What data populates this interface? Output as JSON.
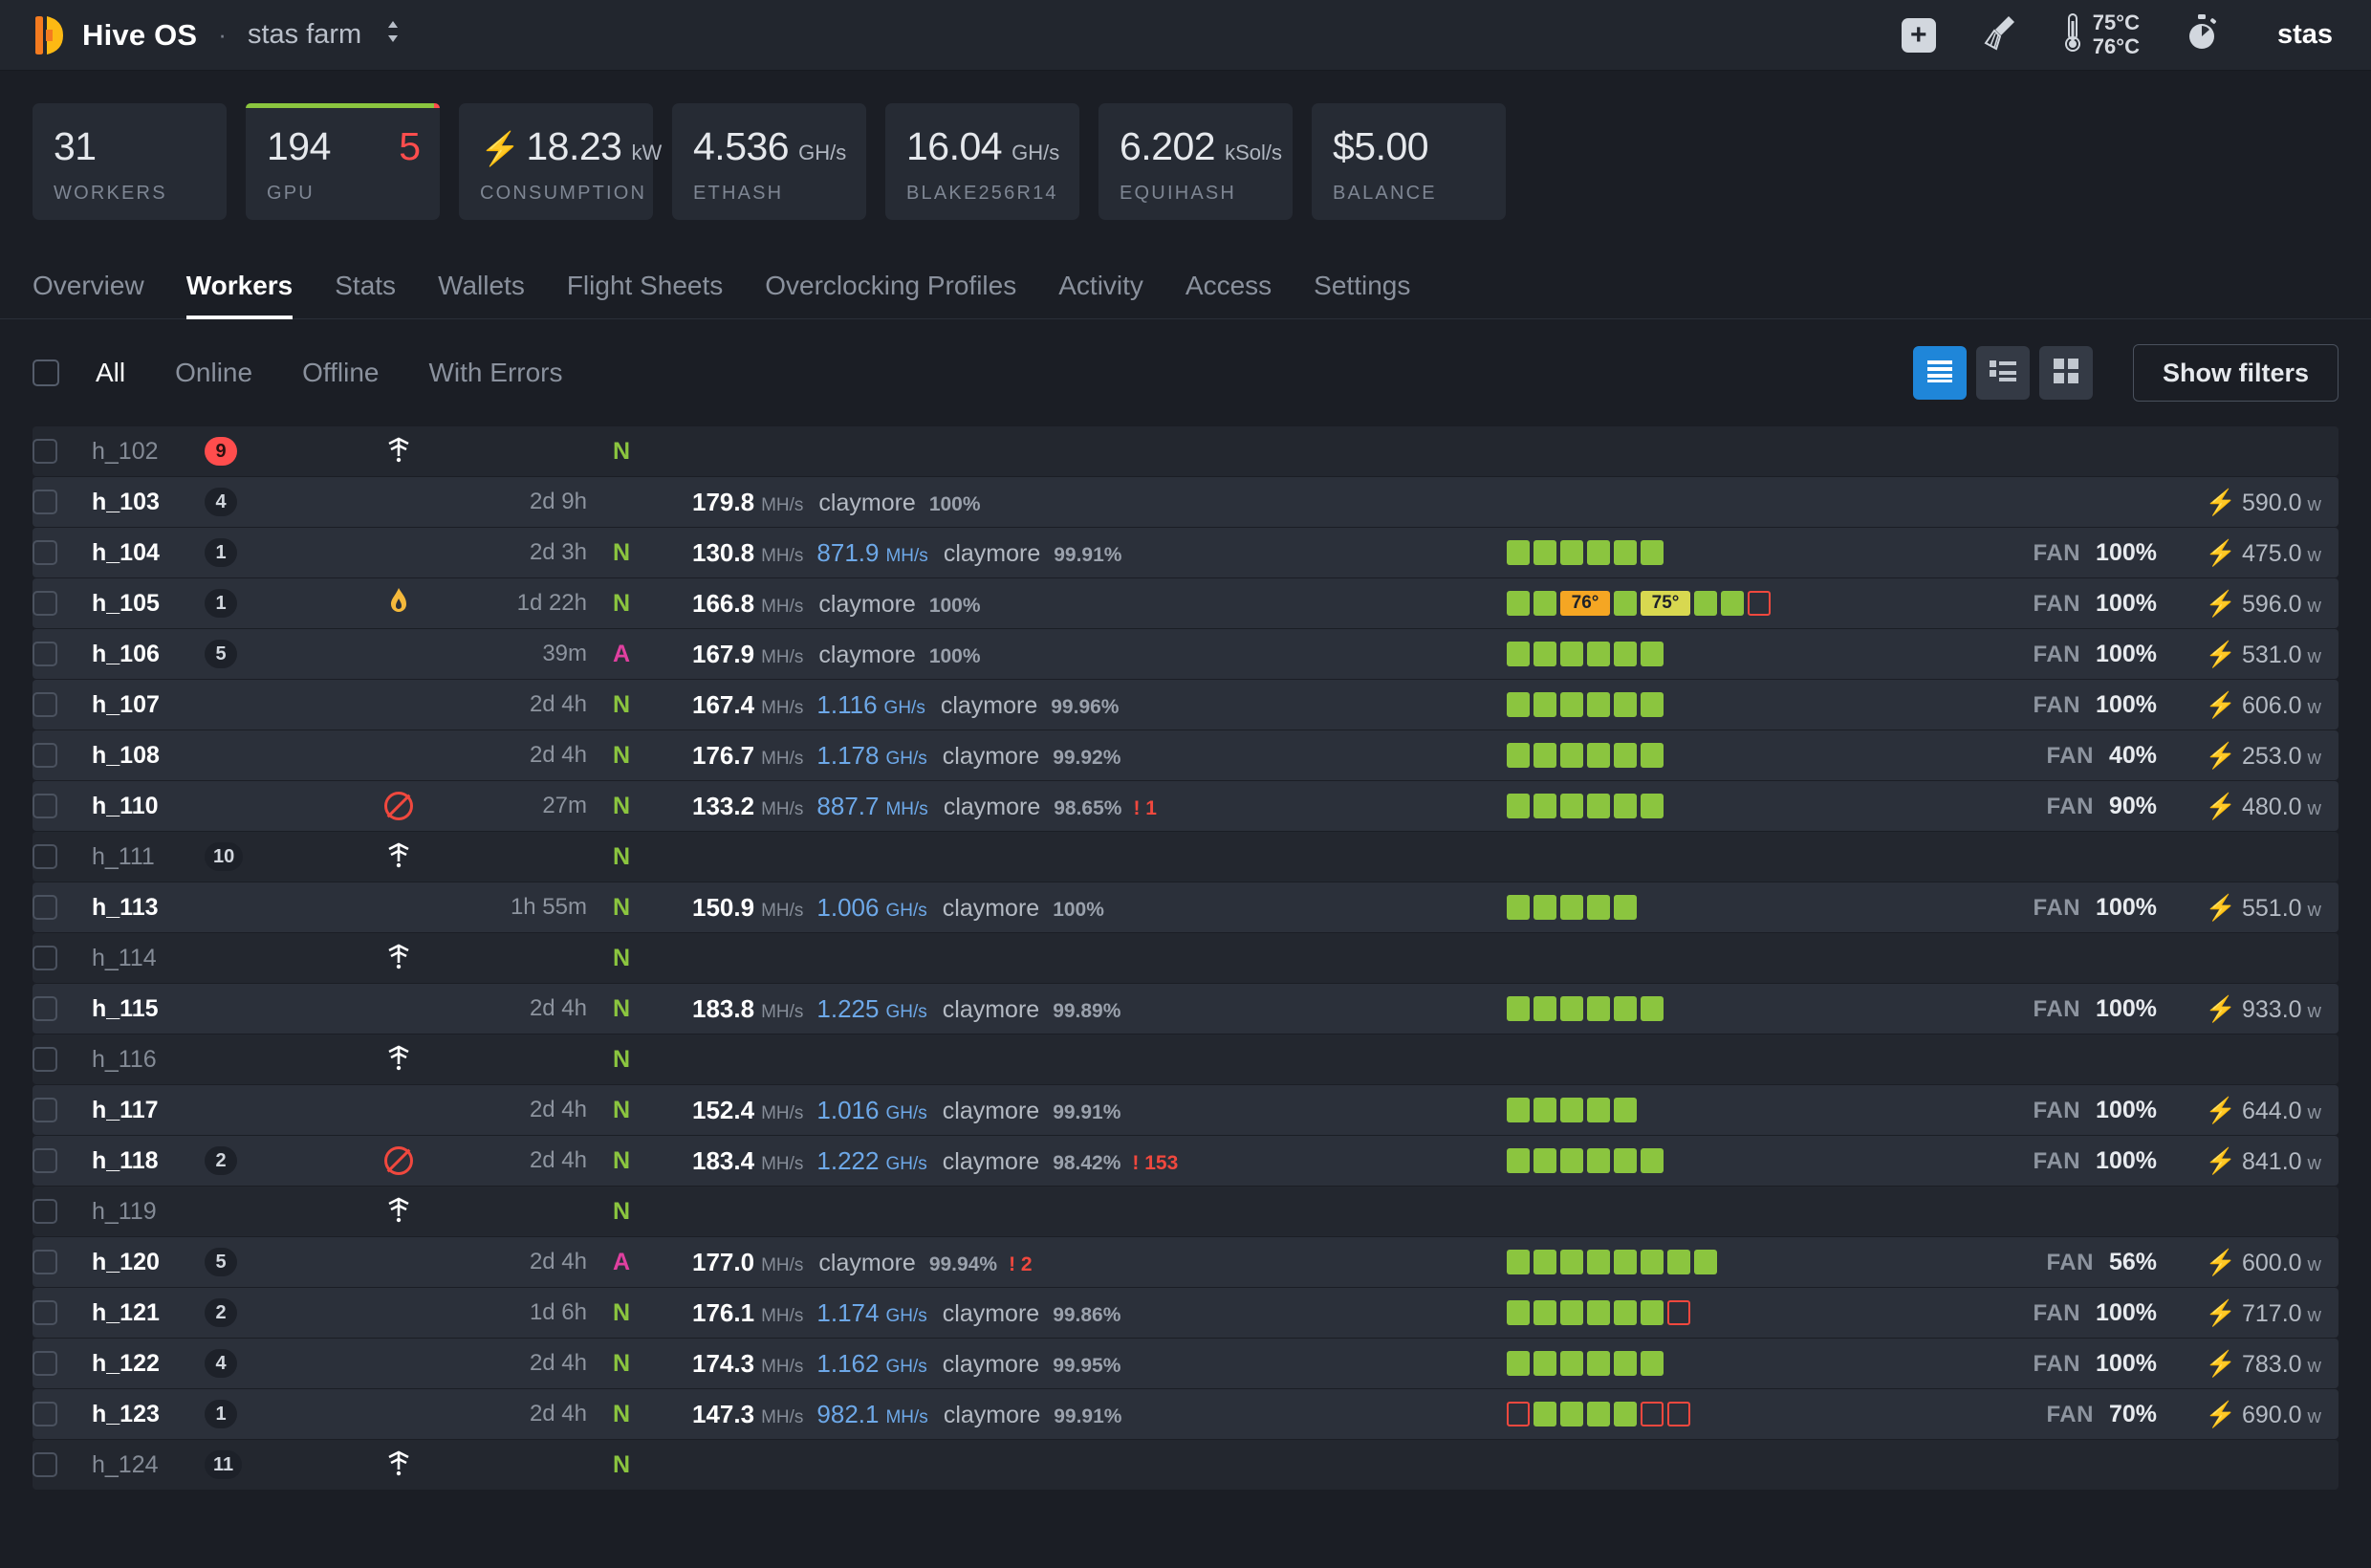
{
  "topbar": {
    "brand": "Hive OS",
    "separator": "·",
    "farm": "stas farm",
    "caret": "⌃⌄",
    "add_icon": "+",
    "broom_icon": "broom-icon",
    "temp_gpu": "75°C",
    "temp_cpu": "76°C",
    "timer_icon": "stopwatch-icon",
    "user": "stas"
  },
  "cards": [
    {
      "value": "31",
      "unit": "",
      "label": "WORKERS",
      "bolt": false,
      "err": "",
      "bar": null
    },
    {
      "value": "194",
      "unit": "",
      "label": "GPU",
      "bolt": false,
      "err": "5",
      "bar": {
        "ok_pct": 97,
        "err_pct": 3
      }
    },
    {
      "value": "18.23",
      "unit": "kW",
      "label": "CONSUMPTION",
      "bolt": true,
      "err": "",
      "bar": null
    },
    {
      "value": "4.536",
      "unit": "GH/s",
      "label": "ETHASH",
      "bolt": false,
      "err": "",
      "bar": null
    },
    {
      "value": "16.04",
      "unit": "GH/s",
      "label": "BLAKE256R14",
      "bolt": false,
      "err": "",
      "bar": null
    },
    {
      "value": "6.202",
      "unit": "kSol/s",
      "label": "EQUIHASH",
      "bolt": false,
      "err": "",
      "bar": null
    },
    {
      "value": "$5.00",
      "unit": "",
      "label": "BALANCE",
      "bolt": false,
      "err": "",
      "bar": null
    }
  ],
  "nav_tabs": [
    {
      "label": "Overview",
      "active": false
    },
    {
      "label": "Workers",
      "active": true
    },
    {
      "label": "Stats",
      "active": false
    },
    {
      "label": "Wallets",
      "active": false
    },
    {
      "label": "Flight Sheets",
      "active": false
    },
    {
      "label": "Overclocking Profiles",
      "active": false
    },
    {
      "label": "Activity",
      "active": false
    },
    {
      "label": "Access",
      "active": false
    },
    {
      "label": "Settings",
      "active": false
    }
  ],
  "filters": {
    "chips": [
      {
        "label": "All",
        "active": true
      },
      {
        "label": "Online",
        "active": false
      },
      {
        "label": "Offline",
        "active": false
      },
      {
        "label": "With Errors",
        "active": false
      }
    ],
    "views": [
      {
        "icon": "list-rows-icon",
        "active": true
      },
      {
        "icon": "list-detail-icon",
        "active": false
      },
      {
        "icon": "grid-icon",
        "active": false
      }
    ],
    "show_filters_label": "Show filters"
  },
  "colors": {
    "accent": "#1f86d9",
    "ok": "#8bc53f",
    "warn": "#f5a623",
    "warn2": "#d8d850",
    "error": "#f0483e",
    "hash_blue": "#6da8e8",
    "net_alt": "#e040a0",
    "row_bg": "#2b303a",
    "row_bg_offline": "#23272f",
    "page_bg": "#1b1e25"
  },
  "workers": [
    {
      "name": "h_102",
      "badge": "9",
      "badge_red": true,
      "status": "offline",
      "uptime": "",
      "net": "N",
      "net_class": "net-N",
      "offline": true,
      "hash": "",
      "unit": "",
      "hash2": "",
      "unit2": "",
      "miner": "",
      "pct": "",
      "err": "",
      "gpus": [],
      "fan": "",
      "fan_label": "",
      "power": "",
      "power_unit": ""
    },
    {
      "name": "h_103",
      "badge": "4",
      "badge_red": false,
      "status": "",
      "uptime": "2d 9h",
      "net": "",
      "net_class": "",
      "offline": false,
      "hash": "179.8",
      "unit": "MH/s",
      "hash2": "",
      "unit2": "",
      "miner": "claymore",
      "pct": "100%",
      "err": "",
      "gpus": [],
      "fan": "",
      "fan_label": "",
      "power": "590.0",
      "power_unit": "w"
    },
    {
      "name": "h_104",
      "badge": "1",
      "badge_red": false,
      "status": "",
      "uptime": "2d 3h",
      "net": "N",
      "net_class": "net-N",
      "offline": false,
      "hash": "130.8",
      "unit": "MH/s",
      "hash2": "871.9",
      "unit2": "MH/s",
      "miner": "claymore",
      "pct": "99.91%",
      "err": "",
      "gpus": [
        {
          "t": "",
          "c": "ok"
        },
        {
          "t": "",
          "c": "ok"
        },
        {
          "t": "",
          "c": "ok"
        },
        {
          "t": "",
          "c": "ok"
        },
        {
          "t": "",
          "c": "ok"
        },
        {
          "t": "",
          "c": "ok"
        }
      ],
      "fan": "100%",
      "fan_label": "FAN",
      "power": "475.0",
      "power_unit": "w"
    },
    {
      "name": "h_105",
      "badge": "1",
      "badge_red": false,
      "status": "flame",
      "uptime": "1d 22h",
      "net": "N",
      "net_class": "net-N",
      "offline": false,
      "hash": "166.8",
      "unit": "MH/s",
      "hash2": "",
      "unit2": "",
      "miner": "claymore",
      "pct": "100%",
      "err": "",
      "gpus": [
        {
          "t": "",
          "c": "ok"
        },
        {
          "t": "",
          "c": "ok"
        },
        {
          "t": "76°",
          "c": "orange"
        },
        {
          "t": "",
          "c": "ok"
        },
        {
          "t": "75°",
          "c": "yellow"
        },
        {
          "t": "",
          "c": "ok"
        },
        {
          "t": "",
          "c": "ok"
        },
        {
          "t": "",
          "c": "empty"
        }
      ],
      "fan": "100%",
      "fan_label": "FAN",
      "power": "596.0",
      "power_unit": "w"
    },
    {
      "name": "h_106",
      "badge": "5",
      "badge_red": false,
      "status": "",
      "uptime": "39m",
      "net": "A",
      "net_class": "net-A",
      "offline": false,
      "hash": "167.9",
      "unit": "MH/s",
      "hash2": "",
      "unit2": "",
      "miner": "claymore",
      "pct": "100%",
      "err": "",
      "gpus": [
        {
          "t": "",
          "c": "ok"
        },
        {
          "t": "",
          "c": "ok"
        },
        {
          "t": "",
          "c": "ok"
        },
        {
          "t": "",
          "c": "ok"
        },
        {
          "t": "",
          "c": "ok"
        },
        {
          "t": "",
          "c": "ok"
        }
      ],
      "fan": "100%",
      "fan_label": "FAN",
      "power": "531.0",
      "power_unit": "w"
    },
    {
      "name": "h_107",
      "badge": "",
      "badge_red": false,
      "status": "",
      "uptime": "2d 4h",
      "net": "N",
      "net_class": "net-N",
      "offline": false,
      "hash": "167.4",
      "unit": "MH/s",
      "hash2": "1.116",
      "unit2": "GH/s",
      "miner": "claymore",
      "pct": "99.96%",
      "err": "",
      "gpus": [
        {
          "t": "",
          "c": "ok"
        },
        {
          "t": "",
          "c": "ok"
        },
        {
          "t": "",
          "c": "ok"
        },
        {
          "t": "",
          "c": "ok"
        },
        {
          "t": "",
          "c": "ok"
        },
        {
          "t": "",
          "c": "ok"
        }
      ],
      "fan": "100%",
      "fan_label": "FAN",
      "power": "606.0",
      "power_unit": "w"
    },
    {
      "name": "h_108",
      "badge": "",
      "badge_red": false,
      "status": "",
      "uptime": "2d 4h",
      "net": "N",
      "net_class": "net-N",
      "offline": false,
      "hash": "176.7",
      "unit": "MH/s",
      "hash2": "1.178",
      "unit2": "GH/s",
      "miner": "claymore",
      "pct": "99.92%",
      "err": "",
      "gpus": [
        {
          "t": "",
          "c": "ok"
        },
        {
          "t": "",
          "c": "ok"
        },
        {
          "t": "",
          "c": "ok"
        },
        {
          "t": "",
          "c": "ok"
        },
        {
          "t": "",
          "c": "ok"
        },
        {
          "t": "",
          "c": "ok"
        }
      ],
      "fan": "40%",
      "fan_label": "FAN",
      "power": "253.0",
      "power_unit": "w"
    },
    {
      "name": "h_110",
      "badge": "",
      "badge_red": false,
      "status": "noentry",
      "uptime": "27m",
      "net": "N",
      "net_class": "net-N",
      "offline": false,
      "hash": "133.2",
      "unit": "MH/s",
      "hash2": "887.7",
      "unit2": "MH/s",
      "miner": "claymore",
      "pct": "98.65%",
      "err": "! 1",
      "gpus": [
        {
          "t": "",
          "c": "ok"
        },
        {
          "t": "",
          "c": "ok"
        },
        {
          "t": "",
          "c": "ok"
        },
        {
          "t": "",
          "c": "ok"
        },
        {
          "t": "",
          "c": "ok"
        },
        {
          "t": "",
          "c": "ok"
        }
      ],
      "fan": "90%",
      "fan_label": "FAN",
      "power": "480.0",
      "power_unit": "w"
    },
    {
      "name": "h_111",
      "badge": "10",
      "badge_red": false,
      "status": "offline",
      "uptime": "",
      "net": "N",
      "net_class": "net-N",
      "offline": true,
      "hash": "",
      "unit": "",
      "hash2": "",
      "unit2": "",
      "miner": "",
      "pct": "",
      "err": "",
      "gpus": [],
      "fan": "",
      "fan_label": "",
      "power": "",
      "power_unit": ""
    },
    {
      "name": "h_113",
      "badge": "",
      "badge_red": false,
      "status": "",
      "uptime": "1h 55m",
      "net": "N",
      "net_class": "net-N",
      "offline": false,
      "hash": "150.9",
      "unit": "MH/s",
      "hash2": "1.006",
      "unit2": "GH/s",
      "miner": "claymore",
      "pct": "100%",
      "err": "",
      "gpus": [
        {
          "t": "",
          "c": "ok"
        },
        {
          "t": "",
          "c": "ok"
        },
        {
          "t": "",
          "c": "ok"
        },
        {
          "t": "",
          "c": "ok"
        },
        {
          "t": "",
          "c": "ok"
        }
      ],
      "fan": "100%",
      "fan_label": "FAN",
      "power": "551.0",
      "power_unit": "w"
    },
    {
      "name": "h_114",
      "badge": "",
      "badge_red": false,
      "status": "offline",
      "uptime": "",
      "net": "N",
      "net_class": "net-N",
      "offline": true,
      "hash": "",
      "unit": "",
      "hash2": "",
      "unit2": "",
      "miner": "",
      "pct": "",
      "err": "",
      "gpus": [],
      "fan": "",
      "fan_label": "",
      "power": "",
      "power_unit": ""
    },
    {
      "name": "h_115",
      "badge": "",
      "badge_red": false,
      "status": "",
      "uptime": "2d 4h",
      "net": "N",
      "net_class": "net-N",
      "offline": false,
      "hash": "183.8",
      "unit": "MH/s",
      "hash2": "1.225",
      "unit2": "GH/s",
      "miner": "claymore",
      "pct": "99.89%",
      "err": "",
      "gpus": [
        {
          "t": "",
          "c": "ok"
        },
        {
          "t": "",
          "c": "ok"
        },
        {
          "t": "",
          "c": "ok"
        },
        {
          "t": "",
          "c": "ok"
        },
        {
          "t": "",
          "c": "ok"
        },
        {
          "t": "",
          "c": "ok"
        }
      ],
      "fan": "100%",
      "fan_label": "FAN",
      "power": "933.0",
      "power_unit": "w"
    },
    {
      "name": "h_116",
      "badge": "",
      "badge_red": false,
      "status": "offline",
      "uptime": "",
      "net": "N",
      "net_class": "net-N",
      "offline": true,
      "hash": "",
      "unit": "",
      "hash2": "",
      "unit2": "",
      "miner": "",
      "pct": "",
      "err": "",
      "gpus": [],
      "fan": "",
      "fan_label": "",
      "power": "",
      "power_unit": ""
    },
    {
      "name": "h_117",
      "badge": "",
      "badge_red": false,
      "status": "",
      "uptime": "2d 4h",
      "net": "N",
      "net_class": "net-N",
      "offline": false,
      "hash": "152.4",
      "unit": "MH/s",
      "hash2": "1.016",
      "unit2": "GH/s",
      "miner": "claymore",
      "pct": "99.91%",
      "err": "",
      "gpus": [
        {
          "t": "",
          "c": "ok"
        },
        {
          "t": "",
          "c": "ok"
        },
        {
          "t": "",
          "c": "ok"
        },
        {
          "t": "",
          "c": "ok"
        },
        {
          "t": "",
          "c": "ok"
        }
      ],
      "fan": "100%",
      "fan_label": "FAN",
      "power": "644.0",
      "power_unit": "w"
    },
    {
      "name": "h_118",
      "badge": "2",
      "badge_red": false,
      "status": "noentry",
      "uptime": "2d 4h",
      "net": "N",
      "net_class": "net-N",
      "offline": false,
      "hash": "183.4",
      "unit": "MH/s",
      "hash2": "1.222",
      "unit2": "GH/s",
      "miner": "claymore",
      "pct": "98.42%",
      "err": "! 153",
      "gpus": [
        {
          "t": "",
          "c": "ok"
        },
        {
          "t": "",
          "c": "ok"
        },
        {
          "t": "",
          "c": "ok"
        },
        {
          "t": "",
          "c": "ok"
        },
        {
          "t": "",
          "c": "ok"
        },
        {
          "t": "",
          "c": "ok"
        }
      ],
      "fan": "100%",
      "fan_label": "FAN",
      "power": "841.0",
      "power_unit": "w"
    },
    {
      "name": "h_119",
      "badge": "",
      "badge_red": false,
      "status": "offline",
      "uptime": "",
      "net": "N",
      "net_class": "net-N",
      "offline": true,
      "hash": "",
      "unit": "",
      "hash2": "",
      "unit2": "",
      "miner": "",
      "pct": "",
      "err": "",
      "gpus": [],
      "fan": "",
      "fan_label": "",
      "power": "",
      "power_unit": ""
    },
    {
      "name": "h_120",
      "badge": "5",
      "badge_red": false,
      "status": "",
      "uptime": "2d 4h",
      "net": "A",
      "net_class": "net-A",
      "offline": false,
      "hash": "177.0",
      "unit": "MH/s",
      "hash2": "",
      "unit2": "",
      "miner": "claymore",
      "pct": "99.94%",
      "err": "! 2",
      "gpus": [
        {
          "t": "",
          "c": "ok"
        },
        {
          "t": "",
          "c": "ok"
        },
        {
          "t": "",
          "c": "ok"
        },
        {
          "t": "",
          "c": "ok"
        },
        {
          "t": "",
          "c": "ok"
        },
        {
          "t": "",
          "c": "ok"
        },
        {
          "t": "",
          "c": "ok"
        },
        {
          "t": "",
          "c": "ok"
        }
      ],
      "fan": "56%",
      "fan_label": "FAN",
      "power": "600.0",
      "power_unit": "w"
    },
    {
      "name": "h_121",
      "badge": "2",
      "badge_red": false,
      "status": "",
      "uptime": "1d 6h",
      "net": "N",
      "net_class": "net-N",
      "offline": false,
      "hash": "176.1",
      "unit": "MH/s",
      "hash2": "1.174",
      "unit2": "GH/s",
      "miner": "claymore",
      "pct": "99.86%",
      "err": "",
      "gpus": [
        {
          "t": "",
          "c": "ok"
        },
        {
          "t": "",
          "c": "ok"
        },
        {
          "t": "",
          "c": "ok"
        },
        {
          "t": "",
          "c": "ok"
        },
        {
          "t": "",
          "c": "ok"
        },
        {
          "t": "",
          "c": "ok"
        },
        {
          "t": "",
          "c": "empty"
        }
      ],
      "fan": "100%",
      "fan_label": "FAN",
      "power": "717.0",
      "power_unit": "w"
    },
    {
      "name": "h_122",
      "badge": "4",
      "badge_red": false,
      "status": "",
      "uptime": "2d 4h",
      "net": "N",
      "net_class": "net-N",
      "offline": false,
      "hash": "174.3",
      "unit": "MH/s",
      "hash2": "1.162",
      "unit2": "GH/s",
      "miner": "claymore",
      "pct": "99.95%",
      "err": "",
      "gpus": [
        {
          "t": "",
          "c": "ok"
        },
        {
          "t": "",
          "c": "ok"
        },
        {
          "t": "",
          "c": "ok"
        },
        {
          "t": "",
          "c": "ok"
        },
        {
          "t": "",
          "c": "ok"
        },
        {
          "t": "",
          "c": "ok"
        }
      ],
      "fan": "100%",
      "fan_label": "FAN",
      "power": "783.0",
      "power_unit": "w"
    },
    {
      "name": "h_123",
      "badge": "1",
      "badge_red": false,
      "status": "",
      "uptime": "2d 4h",
      "net": "N",
      "net_class": "net-N",
      "offline": false,
      "hash": "147.3",
      "unit": "MH/s",
      "hash2": "982.1",
      "unit2": "MH/s",
      "miner": "claymore",
      "pct": "99.91%",
      "err": "",
      "gpus": [
        {
          "t": "",
          "c": "empty"
        },
        {
          "t": "",
          "c": "ok"
        },
        {
          "t": "",
          "c": "ok"
        },
        {
          "t": "",
          "c": "ok"
        },
        {
          "t": "",
          "c": "ok"
        },
        {
          "t": "",
          "c": "empty"
        },
        {
          "t": "",
          "c": "empty"
        }
      ],
      "fan": "70%",
      "fan_label": "FAN",
      "power": "690.0",
      "power_unit": "w"
    },
    {
      "name": "h_124",
      "badge": "11",
      "badge_red": false,
      "status": "offline",
      "uptime": "",
      "net": "N",
      "net_class": "net-N",
      "offline": true,
      "hash": "",
      "unit": "",
      "hash2": "",
      "unit2": "",
      "miner": "",
      "pct": "",
      "err": "",
      "gpus": [],
      "fan": "",
      "fan_label": "",
      "power": "",
      "power_unit": ""
    }
  ]
}
